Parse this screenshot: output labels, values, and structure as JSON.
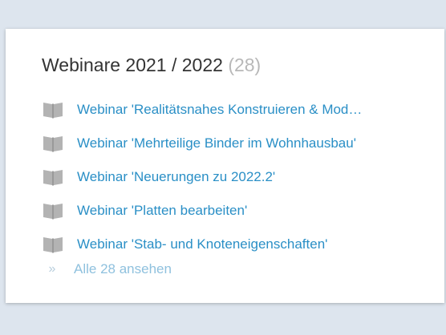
{
  "widget": {
    "title": "Webinare 2021 / 2022",
    "count": "(28)",
    "items": [
      {
        "label": "Webinar 'Realitätsnahes Konstruieren & Mod…",
        "icon": "book-icon"
      },
      {
        "label": "Webinar 'Mehrteilige Binder im Wohnhausbau'",
        "icon": "book-icon"
      },
      {
        "label": "Webinar 'Neuerungen zu 2022.2'",
        "icon": "book-icon"
      },
      {
        "label": "Webinar 'Platten bearbeiten'",
        "icon": "book-icon"
      },
      {
        "label": "Webinar 'Stab- und Knoteneigenschaften'",
        "icon": "book-icon"
      }
    ],
    "see_all": {
      "icon": "double-chevron-right-icon",
      "chevron": "»",
      "label": "Alle 28 ansehen"
    }
  },
  "colors": {
    "background": "#dde5ee",
    "card": "#ffffff",
    "title": "#333333",
    "count": "#b8b8b8",
    "link": "#2a8fc6",
    "see_all": "#8fc1de",
    "icon": "#b3b3b3"
  }
}
